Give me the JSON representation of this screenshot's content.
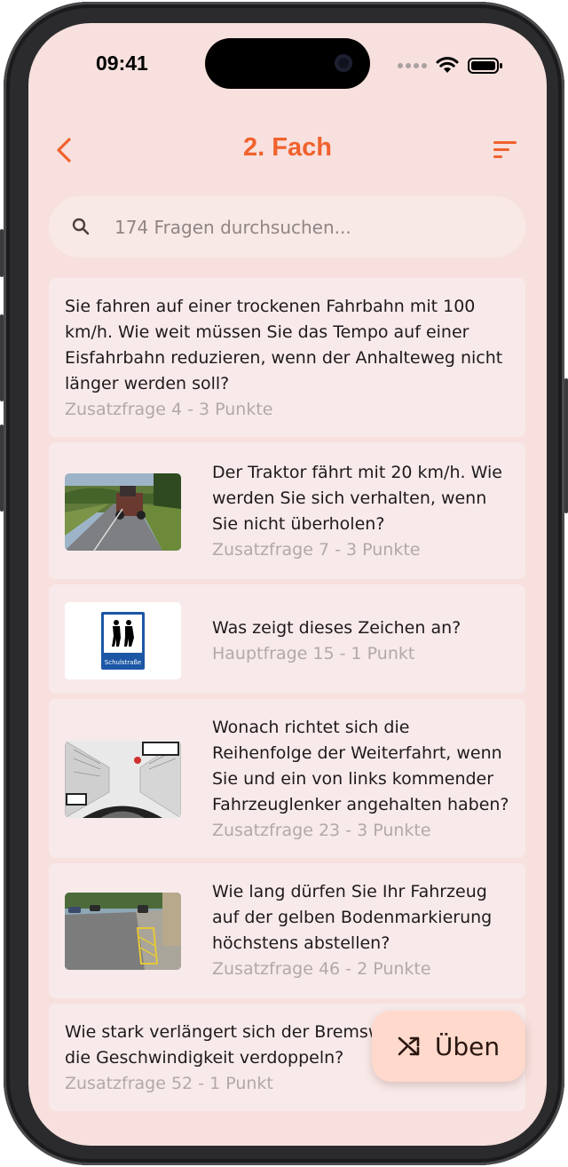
{
  "status": {
    "time": "09:41"
  },
  "nav": {
    "title": "2. Fach",
    "back_icon": "chevron-left-icon",
    "sort_icon": "sort-icon"
  },
  "search": {
    "placeholder": "174 Fragen durchsuchen...",
    "value": ""
  },
  "questions": [
    {
      "text": "Sie fahren auf einer trockenen Fahrbahn mit 100 km/h. Wie weit müssen Sie das Tempo auf einer Eisfahrbahn reduzieren, wenn der Anhalteweg nicht länger werden soll?",
      "meta": "Zusatzfrage 4 - 3 Punkte"
    },
    {
      "text": "Der Traktor fährt mit 20 km/h. Wie werden Sie sich verhalten, wenn Sie nicht überholen?",
      "meta": "Zusatzfrage 7 - 3 Punkte",
      "image": "tractor-road-photo"
    },
    {
      "text": "Was zeigt dieses Zeichen an?",
      "meta": "Hauptfrage 15 - 1 Punkt",
      "image": "schulstrasse-sign",
      "image_text": "Schulstraße"
    },
    {
      "text": "Wonach richtet sich die Reihenfolge der Weiterfahrt, wenn Sie und ein von links kommender Fahrzeuglenker angehalten haben?",
      "meta": "Zusatzfrage 23 - 3 Punkte",
      "image": "intersection-sketch"
    },
    {
      "text": "Wie lang dürfen Sie Ihr Fahrzeug auf der gelben Bodenmarkierung höchstens abstellen?",
      "meta": "Zusatzfrage 46 - 2 Punkte",
      "image": "yellow-marking-photo"
    },
    {
      "text": "Wie stark verlängert sich der Bremsweg, wenn Sie die Geschwindigkeit verdoppeln?",
      "meta": "Zusatzfrage 52 - 1 Punkt"
    }
  ],
  "fab": {
    "label": "Üben",
    "icon": "shuffle-icon"
  },
  "colors": {
    "accent": "#f0622d",
    "background": "#f7e0dd",
    "card": "#f8eaea",
    "fab": "#ffd9cc"
  }
}
